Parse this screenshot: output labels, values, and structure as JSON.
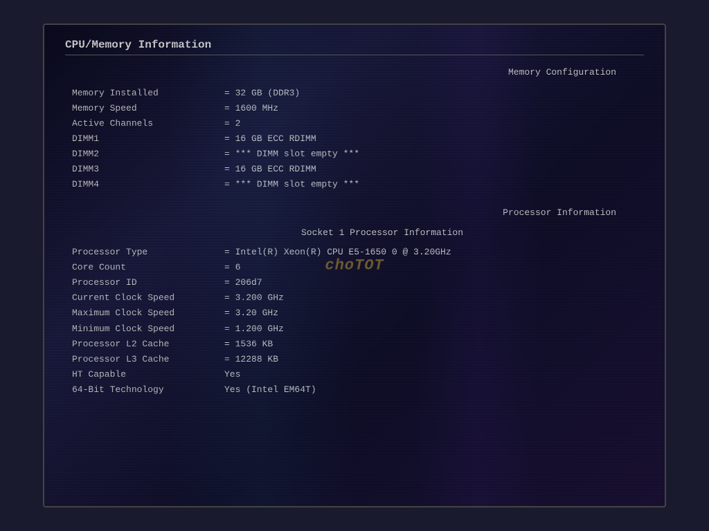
{
  "title": "CPU/Memory Information",
  "watermark": "choTOT",
  "memory": {
    "section_header": "Memory Configuration",
    "fields": [
      {
        "label": "Memory Installed",
        "value": "32 GB (DDR3)"
      },
      {
        "label": "Memory Speed",
        "value": "1600 MHz"
      },
      {
        "label": "Active Channels",
        "value": "2"
      },
      {
        "label": "DIMM1",
        "value": "16 GB ECC RDIMM"
      },
      {
        "label": "DIMM2",
        "value": "*** DIMM slot empty ***"
      },
      {
        "label": "DIMM3",
        "value": "16 GB ECC RDIMM"
      },
      {
        "label": "DIMM4",
        "value": "*** DIMM slot empty ***"
      }
    ]
  },
  "processor": {
    "section_header": "Processor Information",
    "sub_section": "Socket 1 Processor Information",
    "fields": [
      {
        "label": "Processor Type",
        "value": "Intel(R) Xeon(R) CPU E5-1650 0 @ 3.20GHz"
      },
      {
        "label": "Core Count",
        "value": "6"
      },
      {
        "label": "Processor ID",
        "value": "206d7"
      },
      {
        "label": "Current Clock Speed",
        "value": "3.200 GHz"
      },
      {
        "label": "Maximum Clock Speed",
        "value": "3.20 GHz"
      },
      {
        "label": "Minimum Clock Speed",
        "value": "1.200 GHz"
      },
      {
        "label": "Processor L2 Cache",
        "value": "1536 KB"
      },
      {
        "label": "Processor L3 Cache",
        "value": "12288 KB"
      },
      {
        "label": "HT Capable",
        "value": "Yes",
        "no_equals": true
      },
      {
        "label": "64-Bit Technology",
        "value": "Yes (Intel EM64T)",
        "no_equals": true
      }
    ]
  }
}
